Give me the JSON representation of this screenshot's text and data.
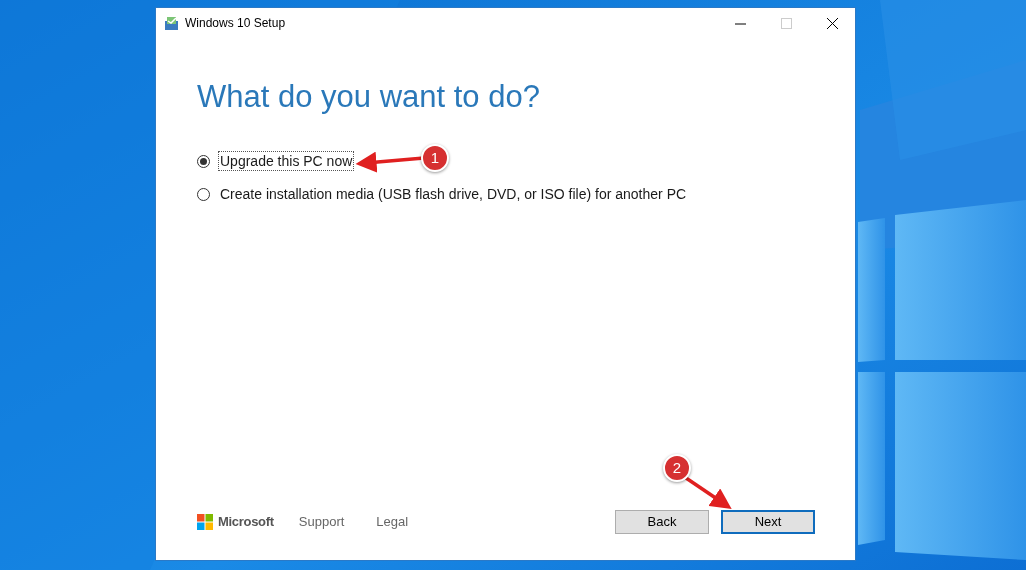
{
  "window": {
    "title": "Windows 10 Setup"
  },
  "heading": "What do you want to do?",
  "options": [
    {
      "label": "Upgrade this PC now",
      "selected": true
    },
    {
      "label": "Create installation media (USB flash drive, DVD, or ISO file) for another PC",
      "selected": false
    }
  ],
  "footer": {
    "brand": "Microsoft",
    "links": [
      "Support",
      "Legal"
    ]
  },
  "buttons": [
    {
      "label": "Back",
      "default": false
    },
    {
      "label": "Next",
      "default": true
    }
  ],
  "annotations": [
    {
      "number": "1"
    },
    {
      "number": "2"
    }
  ]
}
